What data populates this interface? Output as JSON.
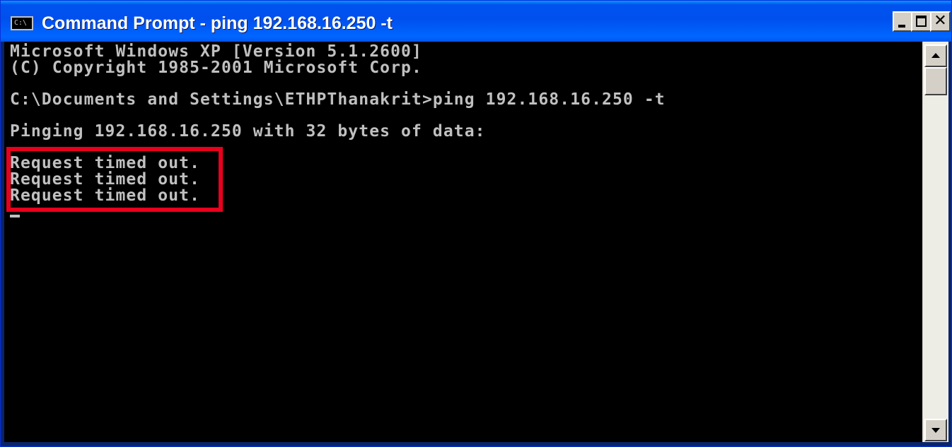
{
  "window": {
    "title": "Command Prompt - ping 192.168.16.250 -t",
    "icon": "cmd-console-icon",
    "icon_text": "C:\\"
  },
  "titlebar_buttons": {
    "minimize_icon": "minimize-icon",
    "maximize_icon": "maximize-icon",
    "close_icon": "close-icon",
    "close_glyph": "✕"
  },
  "console": {
    "lines": [
      "Microsoft Windows XP [Version 5.1.2600]",
      "(C) Copyright 1985-2001 Microsoft Corp.",
      "",
      "C:\\Documents and Settings\\ETHPThanakrit>ping 192.168.16.250 -t",
      "",
      "Pinging 192.168.16.250 with 32 bytes of data:",
      "",
      "Request timed out.",
      "Request timed out.",
      "Request timed out."
    ]
  },
  "colors": {
    "titlebar": "#0055ea",
    "console_bg": "#000000",
    "console_text": "#c0c0c0",
    "highlight": "#e8001c"
  },
  "scrollbar": {
    "up_icon": "scroll-up-arrow-icon",
    "down_icon": "scroll-down-arrow-icon"
  }
}
